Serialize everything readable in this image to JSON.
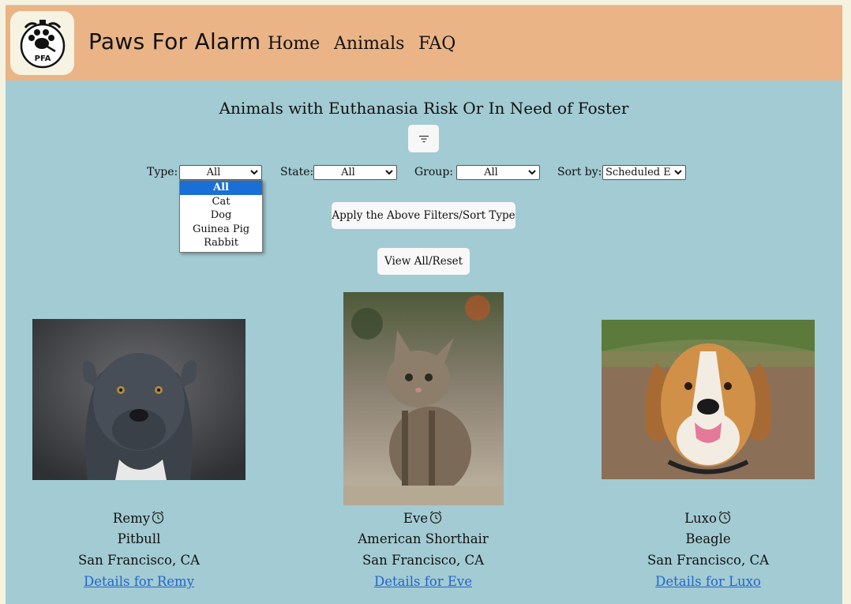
{
  "header": {
    "site_title": "Paws For Alarm",
    "logo_text": "PFA",
    "nav": {
      "home": "Home",
      "animals": "Animals",
      "faq": "FAQ"
    }
  },
  "main": {
    "heading": "Animals with Euthanasia Risk Or In Need of Foster",
    "filter_icon": "filter-lines-icon"
  },
  "filters": {
    "type_label": "Type:",
    "type_value": "All",
    "type_options": [
      "All",
      "Cat",
      "Dog",
      "Guinea Pig",
      "Rabbit"
    ],
    "state_label": "State:",
    "state_value": "All",
    "group_label": "Group:",
    "group_value": "All",
    "sort_label": "Sort by:",
    "sort_value": "Scheduled Eu",
    "apply_button": "Apply the Above Filters/Sort Type",
    "reset_button": "View All/Reset"
  },
  "animals": [
    {
      "name": "Remy",
      "breed": "Pitbull",
      "location": "San Francisco, CA",
      "link": "Details for Remy",
      "icon": "alarm-clock-icon"
    },
    {
      "name": "Eve",
      "breed": "American Shorthair",
      "location": "San Francisco, CA",
      "link": "Details for Eve",
      "icon": "alarm-clock-icon"
    },
    {
      "name": "Luxo",
      "breed": "Beagle",
      "location": "San Francisco, CA",
      "link": "Details for Luxo",
      "icon": "alarm-clock-icon"
    }
  ],
  "colors": {
    "header_bg": "#eab487",
    "page_bg": "#a2cbd3",
    "link": "#2366c9",
    "selected_option": "#1a6fd6"
  }
}
